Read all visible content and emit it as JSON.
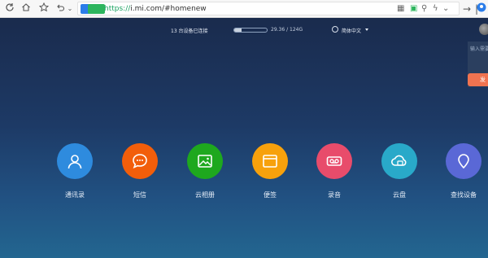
{
  "browser": {
    "url_protocol": "https://",
    "url_rest": "i.mi.com/#homenew"
  },
  "header": {
    "devices_text": "13 台设备已连接",
    "storage_text": "29.36 / 124G",
    "storage_used_fraction": 0.237,
    "language": "简体中文"
  },
  "side": {
    "input_placeholder": "输入需要",
    "button_label": "发"
  },
  "apps": [
    {
      "label": "通讯录",
      "color": "#2e8bde",
      "icon": "contacts-icon"
    },
    {
      "label": "短信",
      "color": "#f25e0a",
      "icon": "message-icon"
    },
    {
      "label": "云相册",
      "color": "#1ea81e",
      "icon": "gallery-icon"
    },
    {
      "label": "便签",
      "color": "#f7a10c",
      "icon": "notes-icon"
    },
    {
      "label": "录音",
      "color": "#e84c6b",
      "icon": "recorder-icon"
    },
    {
      "label": "云盘",
      "color": "#29a9c9",
      "icon": "cloud-drive-icon"
    },
    {
      "label": "查找设备",
      "color": "#5a68d6",
      "icon": "find-device-icon"
    }
  ]
}
